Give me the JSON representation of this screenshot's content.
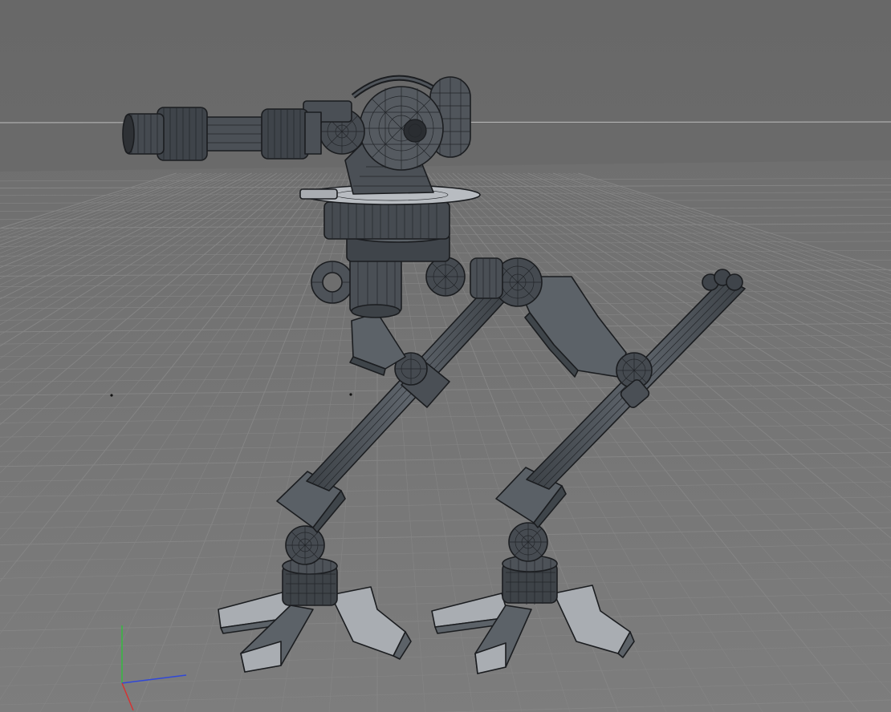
{
  "viewport": {
    "projection": "perspective",
    "display_mode": "shaded-wireframe",
    "grid": true,
    "axes": [
      "x",
      "y",
      "z"
    ]
  },
  "colors": {
    "sky": "#6e6e6e",
    "floor": "#767676",
    "grid_line": "#858585",
    "horizon_line": "#bdbdbd",
    "model_dark": "#494e54",
    "model_mid": "#5f656c",
    "model_light": "#a7abb0",
    "edges": "#1b1d20",
    "axis_x": "#3048d8",
    "axis_y": "#2fbf3a",
    "axis_z": "#d83030"
  },
  "icons": {
    "model": "walker-turret-mech-icon",
    "axis_gizmo": "xyz-axis-gizmo-icon"
  }
}
